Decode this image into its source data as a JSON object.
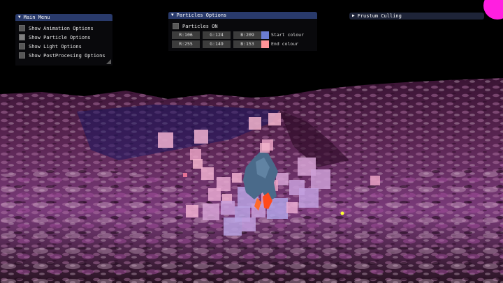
{
  "main_menu": {
    "title": "Main Menu",
    "items": [
      {
        "label": "Show Animation Options",
        "checked": false
      },
      {
        "label": "Show Particle Options",
        "checked": true
      },
      {
        "label": "Show Light Options",
        "checked": false
      },
      {
        "label": "Show PostProcesing Options",
        "checked": false
      }
    ]
  },
  "particles": {
    "title": "Particles Options",
    "on_label": "Particles ON",
    "on_checked": false,
    "start": {
      "r": "R:106",
      "g": "G:124",
      "b": "B:209",
      "label": "Start colour",
      "color": "#6a7cd1"
    },
    "end": {
      "r": "R:255",
      "g": "G:149",
      "b": "B:153",
      "label": "End colour",
      "color": "#ff9599"
    }
  },
  "frustum": {
    "title": "Frustum Culling",
    "collapsed": true
  },
  "colors": {
    "titlebar": "#293a6b",
    "terrain_purple": "#8a3c8c",
    "particle_pink": "#e9a2c4",
    "character": "#4a6a8a"
  }
}
